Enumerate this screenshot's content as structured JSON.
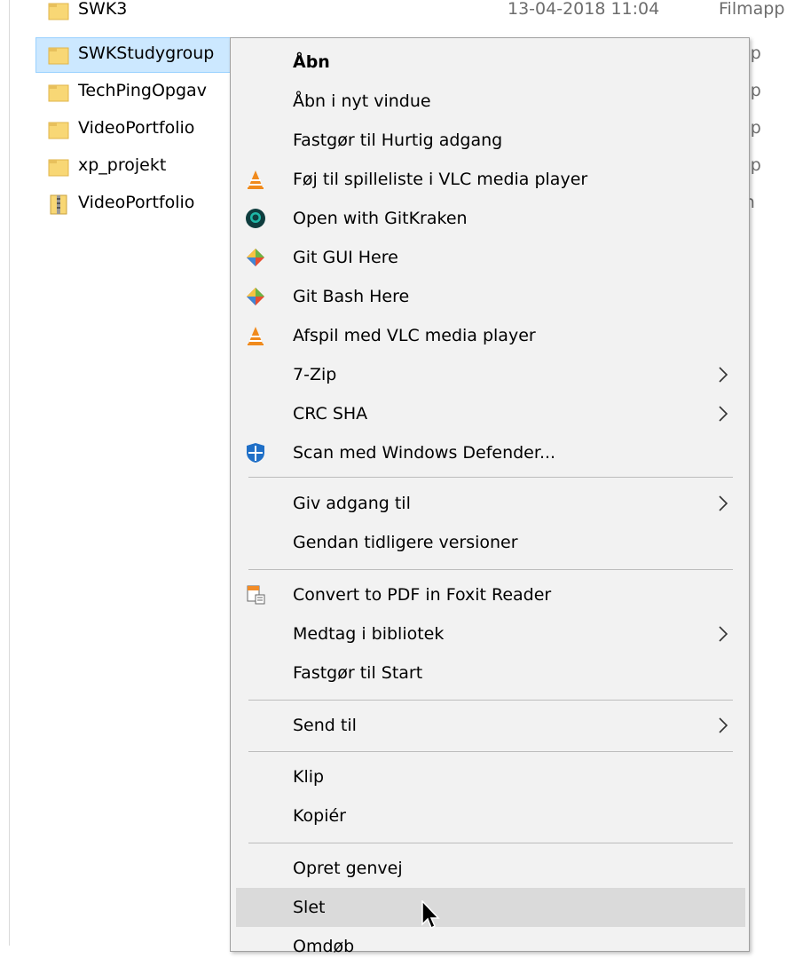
{
  "file_list": {
    "rows": [
      {
        "name": "SWK3",
        "date": "13-04-2018 11:04",
        "type": "Filmapp"
      },
      {
        "name": "SWKStudygroup",
        "date": "",
        "type": "napp"
      },
      {
        "name": "TechPingOpgav",
        "date": "",
        "type": "napp"
      },
      {
        "name": "VideoPortfolio",
        "date": "",
        "type": "napp"
      },
      {
        "name": "xp_projekt",
        "date": "",
        "type": "napp"
      },
      {
        "name": "VideoPortfolio",
        "date": "",
        "type": "-kon"
      }
    ]
  },
  "context_menu": {
    "items": [
      {
        "label": "Åbn",
        "icon": ""
      },
      {
        "label": "Åbn i nyt vindue",
        "icon": ""
      },
      {
        "label": "Fastgør til Hurtig adgang",
        "icon": ""
      },
      {
        "label": "Føj til spilleliste i VLC media player",
        "icon": "vlc-icon"
      },
      {
        "label": "Open with GitKraken",
        "icon": "gitkraken-icon"
      },
      {
        "label": "Git GUI Here",
        "icon": "git-icon"
      },
      {
        "label": "Git Bash Here",
        "icon": "git-icon"
      },
      {
        "label": "Afspil med VLC media player",
        "icon": "vlc-icon"
      },
      {
        "label": "7-Zip",
        "icon": "chevron-right-icon"
      },
      {
        "label": "CRC SHA",
        "icon": "chevron-right-icon"
      },
      {
        "label": "Scan med Windows Defender...",
        "icon": "windows-defender-icon"
      },
      {
        "label": "Giv adgang til",
        "icon": "chevron-right-icon"
      },
      {
        "label": "Gendan tidligere versioner",
        "icon": ""
      },
      {
        "label": "Convert to PDF in Foxit Reader",
        "icon": "foxit-icon"
      },
      {
        "label": "Medtag i bibliotek",
        "icon": "chevron-right-icon"
      },
      {
        "label": "Fastgør til Start",
        "icon": ""
      },
      {
        "label": "Send til",
        "icon": "chevron-right-icon"
      },
      {
        "label": "Klip",
        "icon": ""
      },
      {
        "label": "Kopiér",
        "icon": ""
      },
      {
        "label": "Opret genvej",
        "icon": ""
      },
      {
        "label": "Slet",
        "icon": ""
      },
      {
        "label": "Omdøb",
        "icon": ""
      }
    ]
  },
  "colors": {
    "selection": "#cce8ff",
    "menu_background": "#f2f2f2",
    "hover": "#dadada",
    "folder": "#f8d775"
  }
}
